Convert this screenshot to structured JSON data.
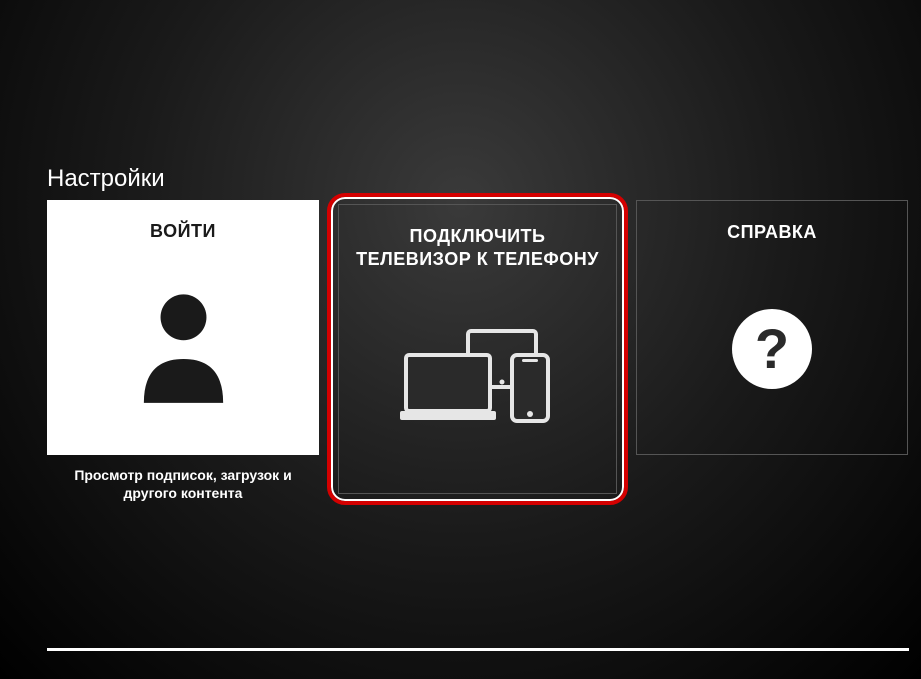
{
  "page": {
    "title": "Настройки"
  },
  "cards": {
    "login": {
      "title": "ВОЙТИ",
      "subtitle": "Просмотр подписок, загрузок и другого контента"
    },
    "connect": {
      "title": "ПОДКЛЮЧИТЬ ТЕЛЕВИЗОР К ТЕЛЕФОНУ"
    },
    "help": {
      "title": "СПРАВКА",
      "icon_glyph": "?"
    }
  }
}
